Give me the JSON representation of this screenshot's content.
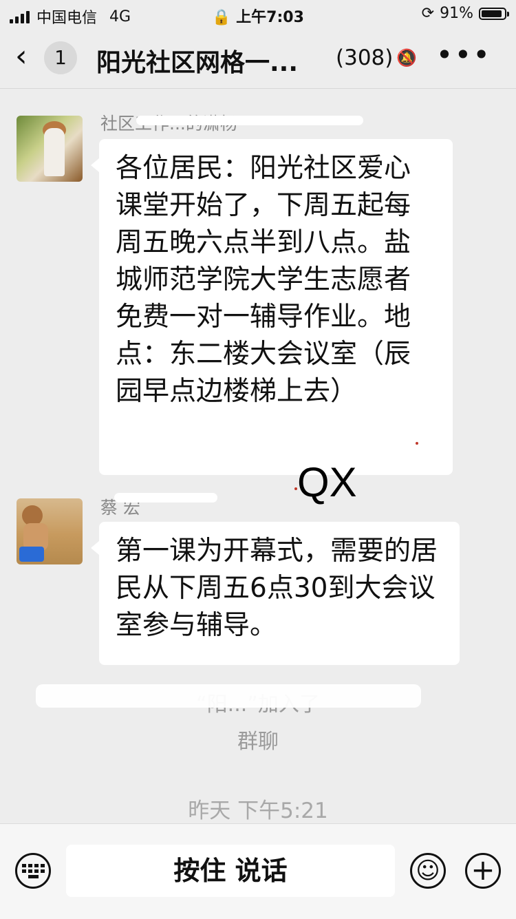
{
  "status_bar": {
    "carrier": "中国电信",
    "network": "4G",
    "time": "上午7:03",
    "battery_percent": "91%",
    "battery_level": 0.91
  },
  "nav": {
    "back_icon": "chevron-left-icon",
    "unread_count": "1",
    "title": "阳光社区网格一...",
    "member_count": "(308)",
    "mute_icon": "bell-slash-icon",
    "more_icon": "more-dots-icon",
    "more_label": "•••"
  },
  "messages": [
    {
      "sender": "社区工作...的潇杨",
      "text": "各位居民：阳光社区爱心课堂开始了，下周五起每周五晚六点半到八点。盐城师范学院大学生志愿者免费一对一辅导作业。地点：东二楼大会议室（辰园早点边楼梯上去）"
    },
    {
      "sender": "蔡 宏",
      "text": "第一课为开幕式，需要的居民从下周五6点30到大会议室参与辅导。"
    }
  ],
  "watermark": "QX",
  "system_message": {
    "line1": "“阳...”加入了",
    "line2": "群聊"
  },
  "timestamp": "昨天 下午5:21",
  "input_bar": {
    "keyboard_icon": "keyboard-icon",
    "talk_label": "按住 说话",
    "emoji_icon": "emoji-icon",
    "plus_icon": "plus-icon"
  },
  "colors": {
    "background": "#ededed",
    "bubble": "#ffffff",
    "secondary_text": "#9b9b9b"
  }
}
